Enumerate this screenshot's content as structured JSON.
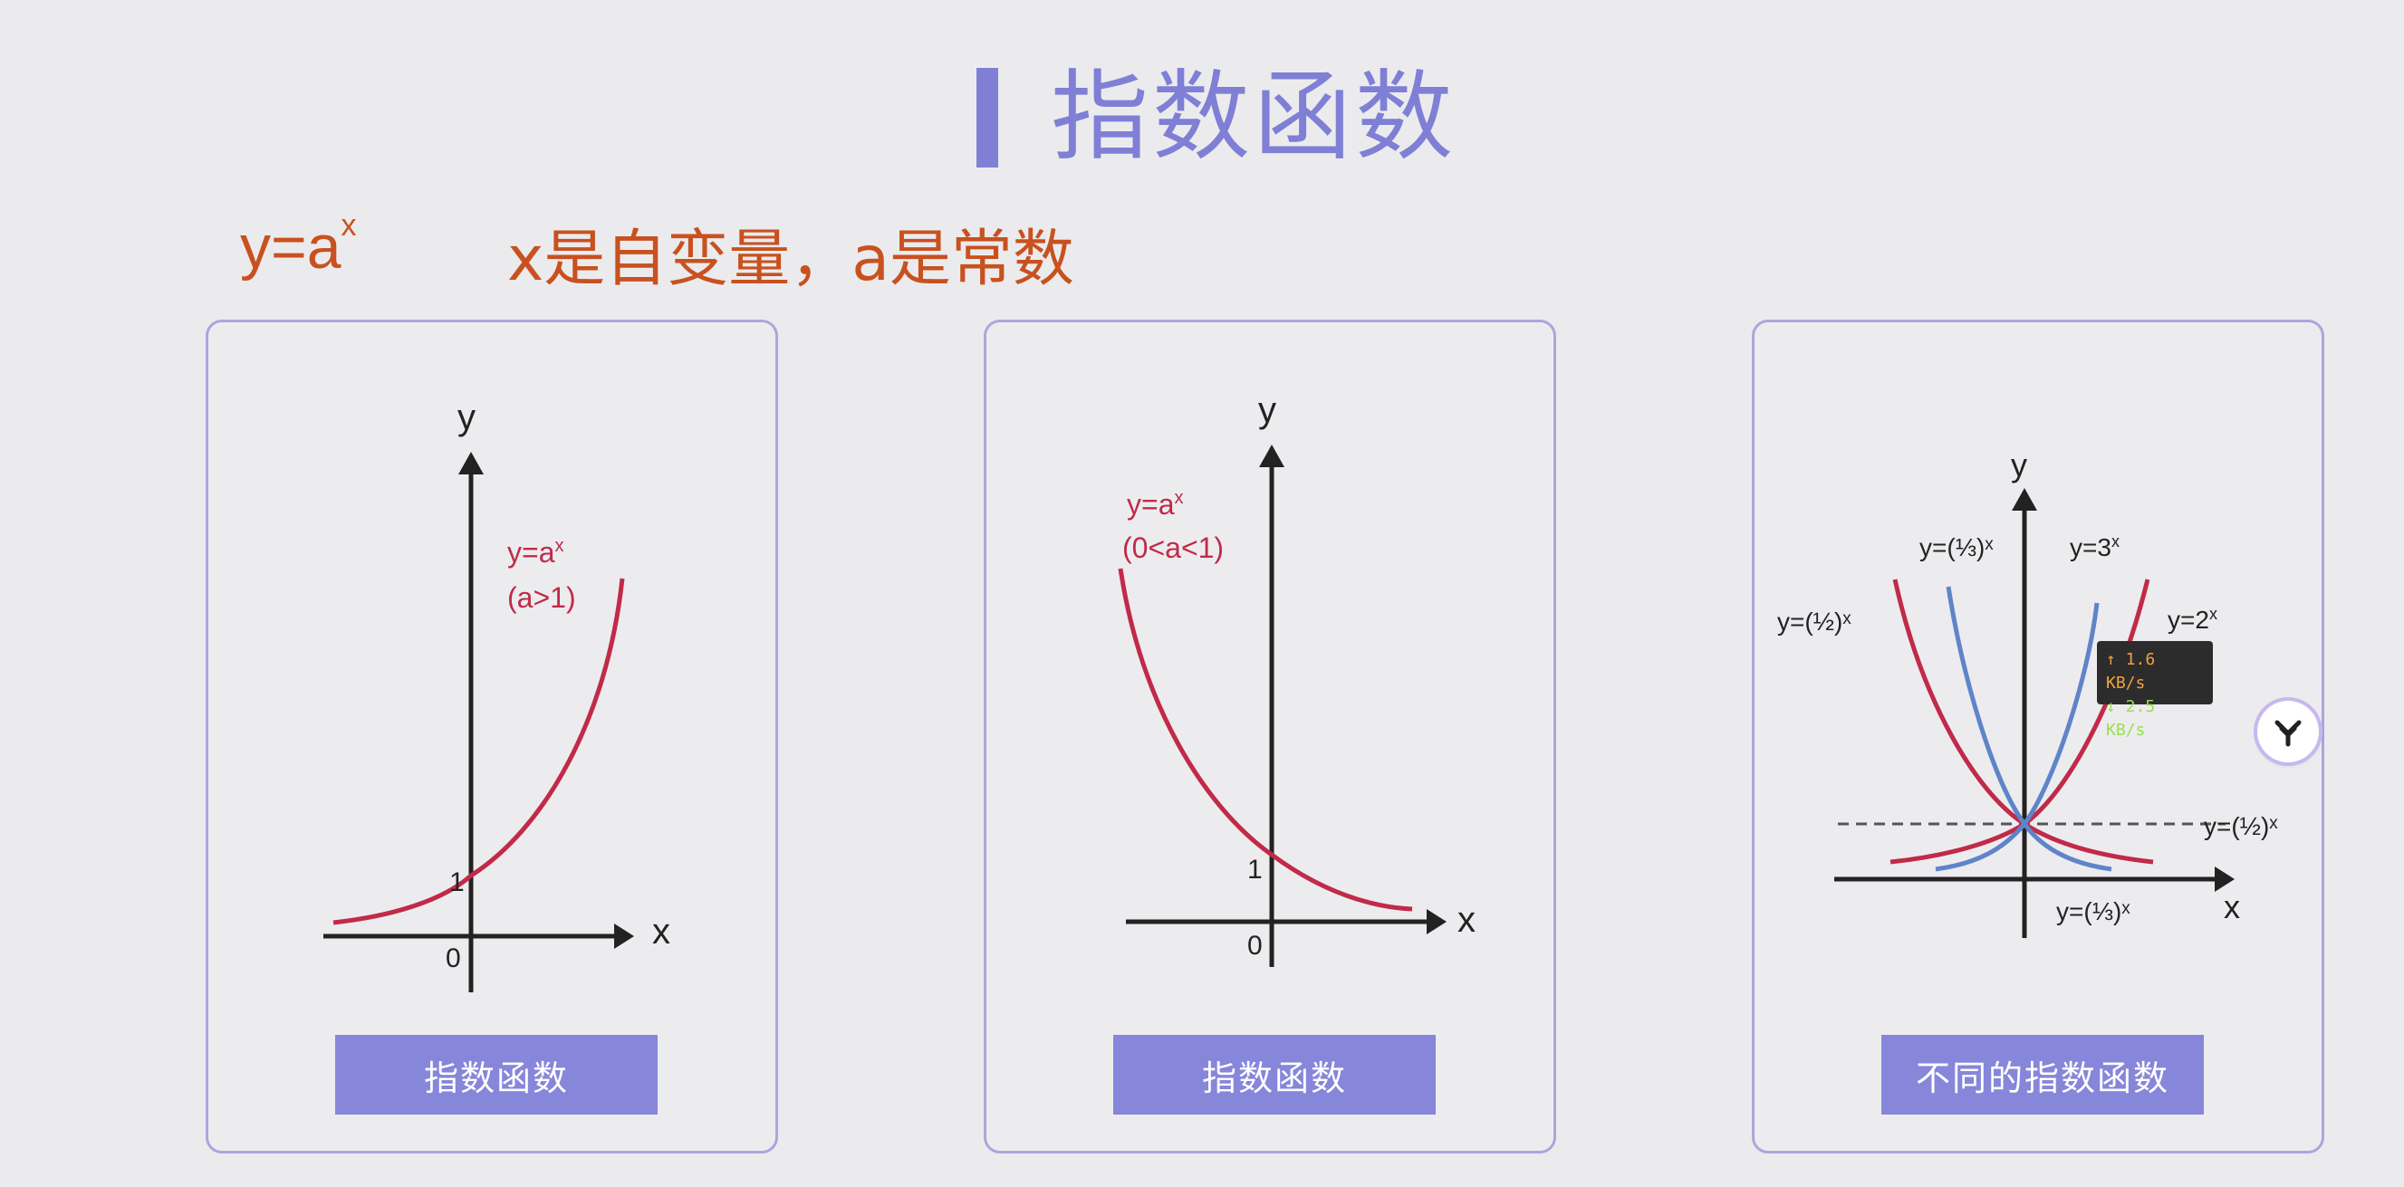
{
  "header": {
    "title": "指数函数"
  },
  "intro": {
    "formula_base": "y=a",
    "formula_exp": "x",
    "description": "x是自变量，a是常数"
  },
  "cards": [
    {
      "button": "指数函数",
      "axis_x": "x",
      "axis_y": "y",
      "origin": "0",
      "intercept": "1",
      "curve_label_1": "y=a",
      "curve_label_exp": "x",
      "curve_label_2": "(a>1)"
    },
    {
      "button": "指数函数",
      "axis_x": "x",
      "axis_y": "y",
      "origin": "0",
      "intercept": "1",
      "curve_label_1": "y=a",
      "curve_label_exp": "x",
      "curve_label_2": "(0<a<1)"
    },
    {
      "button": "不同的指数函数",
      "axis_x": "x",
      "axis_y": "y",
      "labels": {
        "half_left": "y=(½)ˣ",
        "third_top": "y=(⅓)ˣ",
        "three": "y=3",
        "two": "y=2",
        "half_right": "y=(½)ˣ",
        "third_bottom": "y=(⅓)ˣ",
        "exp": "x"
      }
    }
  ],
  "network_tooltip": {
    "upload": "↑ 1.6 KB/s",
    "download": "↓ 2.5 KB/s"
  },
  "colors": {
    "accent": "#7f7fd6",
    "formula": "#c8511f",
    "curve_red": "#c12a48",
    "curve_blue": "#5f84c8"
  }
}
